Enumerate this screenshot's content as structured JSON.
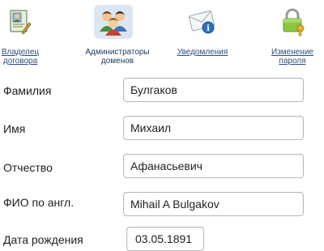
{
  "tabs": [
    {
      "label": "Владелец договора",
      "icon": "contract-owner-icon",
      "active": false
    },
    {
      "label": "Администраторы доменов",
      "icon": "domain-admins-icon",
      "active": true
    },
    {
      "label": "Уведомления",
      "icon": "notifications-icon",
      "active": false
    },
    {
      "label": "Изменение пароля",
      "icon": "change-password-icon",
      "active": false
    }
  ],
  "form": {
    "last_name": {
      "label": "Фамилия",
      "value": "Булгаков"
    },
    "first_name": {
      "label": "Имя",
      "value": "Михаил"
    },
    "patronymic": {
      "label": "Отчество",
      "value": "Афанасьевич"
    },
    "name_en": {
      "label": "ФИО по англ.",
      "value": "Mihail A Bulgakov"
    },
    "birth_date": {
      "label": "Дата рождения",
      "value": "03.05.1891"
    }
  },
  "colors": {
    "link": "#2a4e7e",
    "active_tab_bg": "#dbe6f2",
    "input_border": "#b9b9b9"
  }
}
